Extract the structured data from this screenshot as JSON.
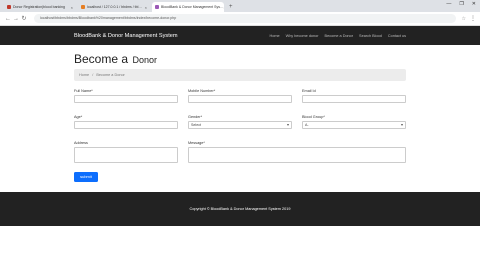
{
  "browser": {
    "tabs": [
      {
        "title": "Donor Registration|blood banking",
        "active": false,
        "favicon_color": "#c0392b"
      },
      {
        "title": "localhost / 127.0.0.1 / bbdms / tbl…",
        "active": false,
        "favicon_color": "#e67e22"
      },
      {
        "title": "BloodBank & Donor Management Sys…",
        "active": true,
        "favicon_color": "#9b59b6"
      }
    ],
    "new_tab": "+",
    "url": "localhost/bbdms/bbdms/Bloodbank%20management/bbdms/index/become-donor.php",
    "window_controls": [
      "—",
      "❐",
      "✕"
    ]
  },
  "site": {
    "brand": "BloodBank & Donor Management System",
    "nav": [
      "Home",
      "Why become donor",
      "Become a Donor",
      "Search Blood",
      "Contact us"
    ]
  },
  "page": {
    "title_big": "Become a",
    "title_small": "Donor",
    "breadcrumb": {
      "home": "Home",
      "sep": "/",
      "current": "Become a Donor"
    }
  },
  "form": {
    "full_name_label": "Full Name*",
    "mobile_label": "Mobile Number*",
    "email_label": "Email Id",
    "age_label": "Age*",
    "gender_label": "Gender*",
    "gender_value": "Select",
    "blood_group_label": "Blood Group*",
    "blood_group_value": "A-",
    "address_label": "Address",
    "message_label": "Message*",
    "submit_label": "submit"
  },
  "footer": {
    "copyright": "Copyright © BloodBank & Donor Management System 2019"
  },
  "colors": {
    "nav_bg": "#222222",
    "primary": "#0d6efd"
  }
}
